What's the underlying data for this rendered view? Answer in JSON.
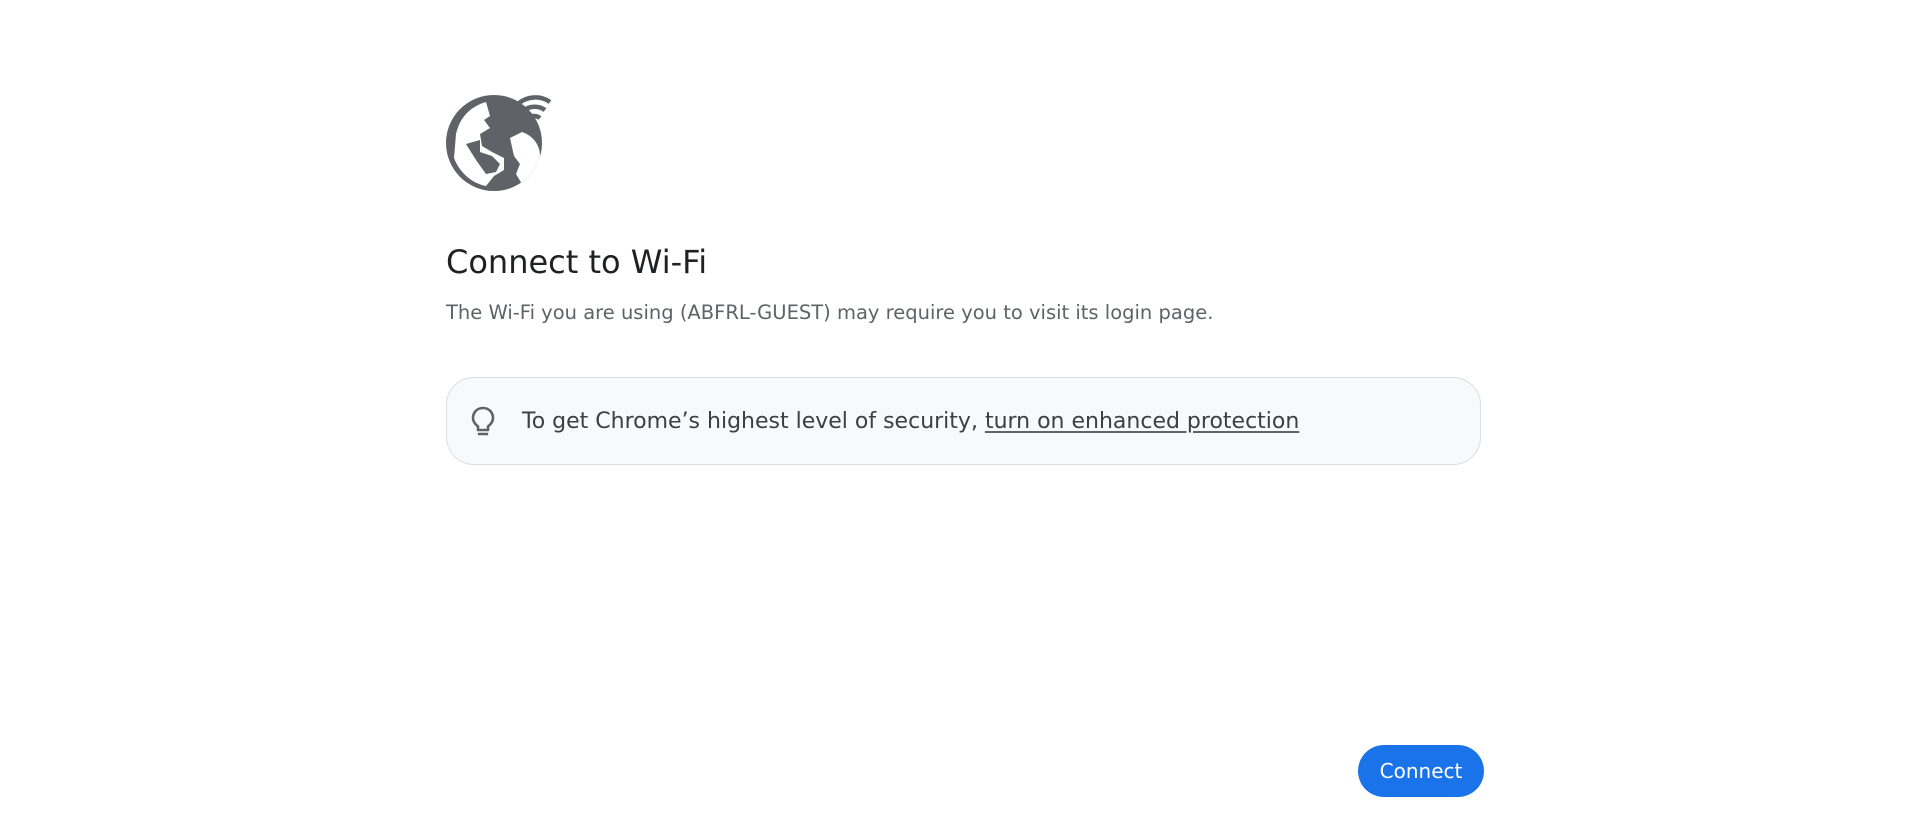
{
  "header": {
    "icon": "globe-wifi-icon",
    "title": "Connect to Wi-Fi",
    "description": "The Wi-Fi you are using (ABFRL-GUEST) may require you to visit its login page."
  },
  "promo": {
    "icon": "lightbulb-icon",
    "text": "To get Chrome’s highest level of security, ",
    "link_text": "turn on enhanced protection"
  },
  "actions": {
    "connect_label": "Connect"
  },
  "colors": {
    "icon": "#5f6368",
    "title": "#202124",
    "body_text": "#5f6368",
    "promo_background": "#f8f9fa",
    "promo_border": "#dadce0",
    "primary_button": "#1a73e8"
  }
}
